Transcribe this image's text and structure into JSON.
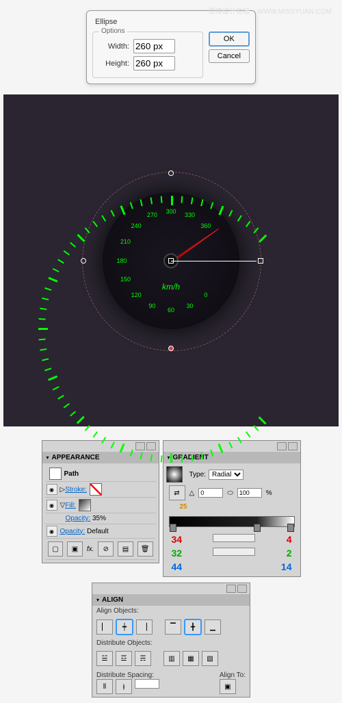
{
  "watermark": {
    "main": "思缘设计论坛",
    "sub": "WWW.MISSYUAN.COM"
  },
  "ellipse": {
    "title": "Ellipse",
    "group": "Options",
    "width_label": "Width:",
    "width": "260 px",
    "height_label": "Height:",
    "height": "260 px",
    "ok": "OK",
    "cancel": "Cancel"
  },
  "gauge": {
    "unit": "km/h",
    "numbers": [
      0,
      30,
      60,
      90,
      120,
      150,
      180,
      210,
      240,
      270,
      300,
      330,
      360
    ]
  },
  "appearance": {
    "title": "APPEARANCE",
    "item": "Path",
    "stroke": "Stroke:",
    "fill": "Fill:",
    "opacity_label": "Opacity:",
    "opacity_val": "35%",
    "opacity2_label": "Opacity:",
    "opacity2_val": "Default"
  },
  "gradient": {
    "title": "GRADIENT",
    "type_label": "Type:",
    "type": "Radial",
    "angle": "0",
    "loc1": "0",
    "loc2": "100",
    "pct": "%",
    "stop_pos": "25",
    "r1": "34",
    "g1": "32",
    "b1": "44",
    "r2": "4",
    "g2": "2",
    "b2": "14"
  },
  "align": {
    "title": "ALIGN",
    "objects": "Align Objects:",
    "distribute": "Distribute Objects:",
    "spacing": "Distribute Spacing:",
    "to": "Align To:"
  }
}
